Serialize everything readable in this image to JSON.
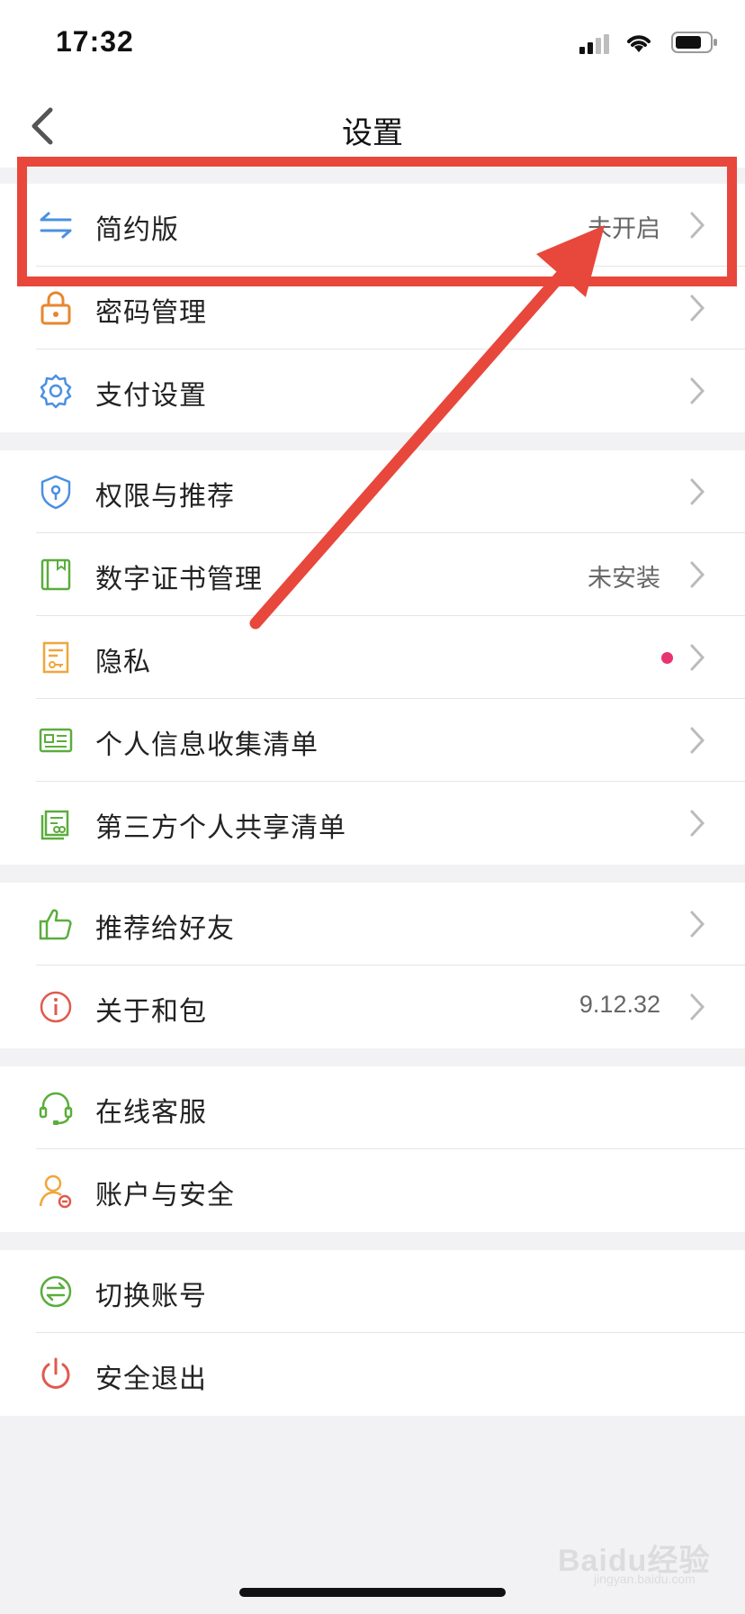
{
  "status_bar": {
    "time": "17:32",
    "icons": [
      "signal-icon",
      "wifi-icon",
      "battery-icon"
    ]
  },
  "nav": {
    "title": "设置",
    "back_icon": "chevron-left-icon"
  },
  "sections": [
    {
      "items": [
        {
          "label": "简约版",
          "value": "未开启",
          "icon": "swap-arrows-icon",
          "color": "#4a90e2"
        },
        {
          "label": "密码管理",
          "value": "",
          "icon": "lock-icon",
          "color": "#e8862f"
        },
        {
          "label": "支付设置",
          "value": "",
          "icon": "gear-icon",
          "color": "#4a90e2"
        }
      ]
    },
    {
      "items": [
        {
          "label": "权限与推荐",
          "value": "",
          "icon": "shield-icon",
          "color": "#4a90e2"
        },
        {
          "label": "数字证书管理",
          "value": "未安装",
          "icon": "certificate-book-icon",
          "color": "#5aad3c"
        },
        {
          "label": "隐私",
          "value": "",
          "icon": "document-key-icon",
          "color": "#f0a63a",
          "dot": true
        },
        {
          "label": "个人信息收集清单",
          "value": "",
          "icon": "id-card-icon",
          "color": "#5aad3c"
        },
        {
          "label": "第三方个人共享清单",
          "value": "",
          "icon": "shared-list-icon",
          "color": "#5aad3c"
        }
      ]
    },
    {
      "items": [
        {
          "label": "推荐给好友",
          "value": "",
          "icon": "thumbs-up-icon",
          "color": "#5aad3c"
        },
        {
          "label": "关于和包",
          "value": "9.12.32",
          "icon": "info-icon",
          "color": "#e05a4e"
        }
      ]
    },
    {
      "items": [
        {
          "label": "在线客服",
          "value": "",
          "icon": "headset-icon",
          "color": "#5aad3c",
          "no_chevron": true
        },
        {
          "label": "账户与安全",
          "value": "",
          "icon": "user-lock-icon",
          "color": "#f0a63a",
          "no_chevron": true
        }
      ]
    },
    {
      "items": [
        {
          "label": "切换账号",
          "value": "",
          "icon": "switch-account-icon",
          "color": "#5aad3c",
          "no_chevron": true
        },
        {
          "label": "安全退出",
          "value": "",
          "icon": "power-icon",
          "color": "#e05a4e",
          "no_chevron": true
        }
      ]
    }
  ],
  "annotation": {
    "highlight_color": "#e8473c"
  },
  "watermark": {
    "text": "Baidu经验",
    "sub": "jingyan.baidu.com"
  }
}
